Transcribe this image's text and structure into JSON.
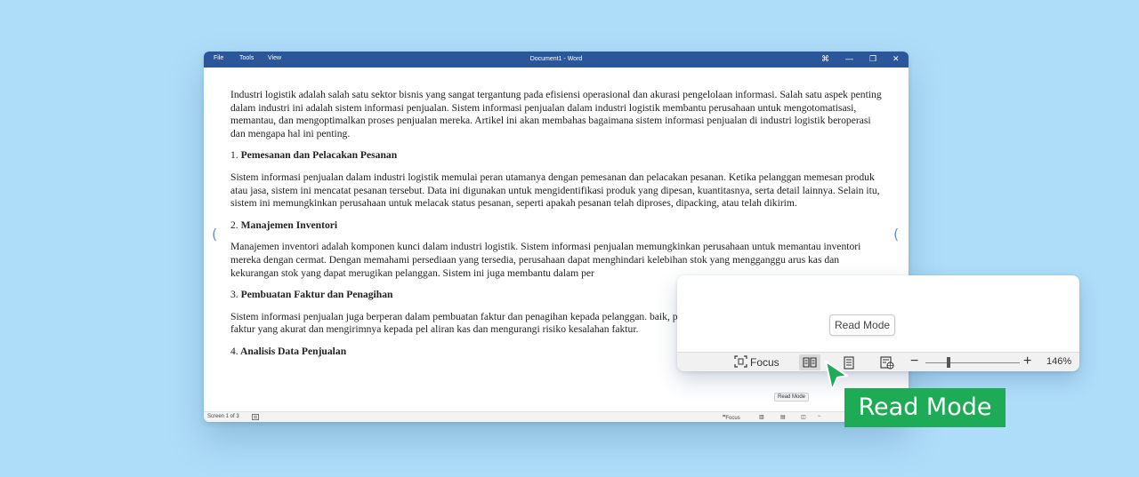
{
  "window": {
    "title": "Document1 - Word",
    "menu": [
      "File",
      "Tools",
      "View"
    ],
    "controls": {
      "fullscreen": "⌘",
      "minimize": "—",
      "restore": "❐",
      "close": "✕"
    }
  },
  "document": {
    "intro": "Industri logistik adalah salah satu sektor bisnis yang sangat tergantung pada efisiensi operasional dan akurasi pengelolaan informasi. Salah satu aspek penting dalam industri ini adalah sistem informasi penjualan. Sistem informasi penjualan dalam industri logistik membantu perusahaan untuk mengotomatisasi, memantau, dan mengoptimalkan proses penjualan mereka. Artikel ini akan membahas bagaimana sistem informasi penjualan di industri logistik beroperasi dan mengapa hal ini penting.",
    "sections": [
      {
        "num": "1.",
        "heading": "Pemesanan dan Pelacakan Pesanan",
        "body": "Sistem informasi penjualan dalam industri logistik memulai peran utamanya dengan pemesanan dan pelacakan pesanan. Ketika pelanggan memesan produk atau jasa, sistem ini mencatat pesanan tersebut. Data ini digunakan untuk mengidentifikasi produk yang dipesan, kuantitasnya, serta detail lainnya. Selain itu, sistem ini memungkinkan perusahaan untuk melacak status pesanan, seperti apakah pesanan telah diproses, dipacking, atau telah dikirim."
      },
      {
        "num": "2.",
        "heading": "Manajemen Inventori",
        "body": "Manajemen inventori adalah komponen kunci dalam industri logistik. Sistem informasi penjualan memungkinkan perusahaan untuk memantau inventori mereka dengan cermat. Dengan memahami persediaan yang tersedia, perusahaan dapat menghindari kelebihan stok yang mengganggu arus kas dan kekurangan stok yang dapat merugikan pelanggan. Sistem ini juga membantu dalam per"
      },
      {
        "num": "3.",
        "heading": "Pembuatan Faktur dan Penagihan",
        "body": "Sistem informasi penjualan juga berperan dalam pembuatan faktur dan penagihan kepada pelanggan. baik, perusahaan dapat dengan mudah menghasilkan faktur yang akurat dan mengirimnya kepada pel aliran kas dan mengurangi risiko kesalahan faktur."
      },
      {
        "num": "4.",
        "heading": "Analisis Data Penjualan",
        "body": ""
      }
    ],
    "margin_glyph": "("
  },
  "statusbar": {
    "page": "Screen 1 of 3",
    "focus": "Focus",
    "tooltip": "Read Mode"
  },
  "zoom_panel": {
    "tooltip": "Read Mode",
    "focus_label": "Focus",
    "zoom_value": "146%",
    "zoom_level_fraction": 0.25
  },
  "callout": {
    "label": "Read Mode",
    "color": "#1eab55"
  },
  "colors": {
    "titlebar": "#2b579a",
    "background": "#aeddf9"
  }
}
